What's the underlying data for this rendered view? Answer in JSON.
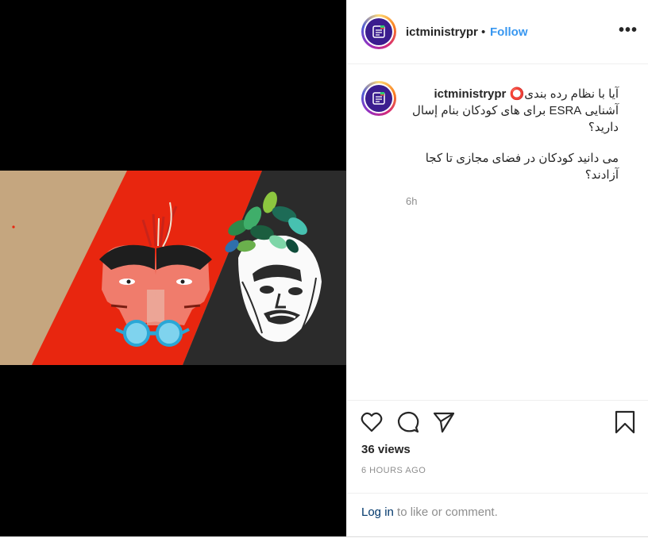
{
  "header": {
    "username": "ictministrypr",
    "separator": "•",
    "follow_label": "Follow",
    "more_icon": "more-horizontal-icon"
  },
  "caption": {
    "username": "ictministrypr",
    "line1": "آیا با نظام رده بندی⭕",
    "line2": "آشنایی ESRA برای های کودکان بنام إسال دارید؟",
    "line3": "می دانید کودکان در فضای مجازی تا کجا آزادند؟",
    "time": "6h"
  },
  "actions": {
    "like_icon": "heart-icon",
    "comment_icon": "comment-icon",
    "share_icon": "send-icon",
    "save_icon": "bookmark-icon",
    "views": "36 views",
    "time_ago": "6 HOURS AGO",
    "login_link": "Log in",
    "login_rest": " to like or comment."
  },
  "colors": {
    "follow": "#3897f0",
    "avatar_bg": "#3b1d8f",
    "video_red": "#e8260f",
    "video_beige": "#c5a67f",
    "video_dark": "#2b2b2b"
  }
}
